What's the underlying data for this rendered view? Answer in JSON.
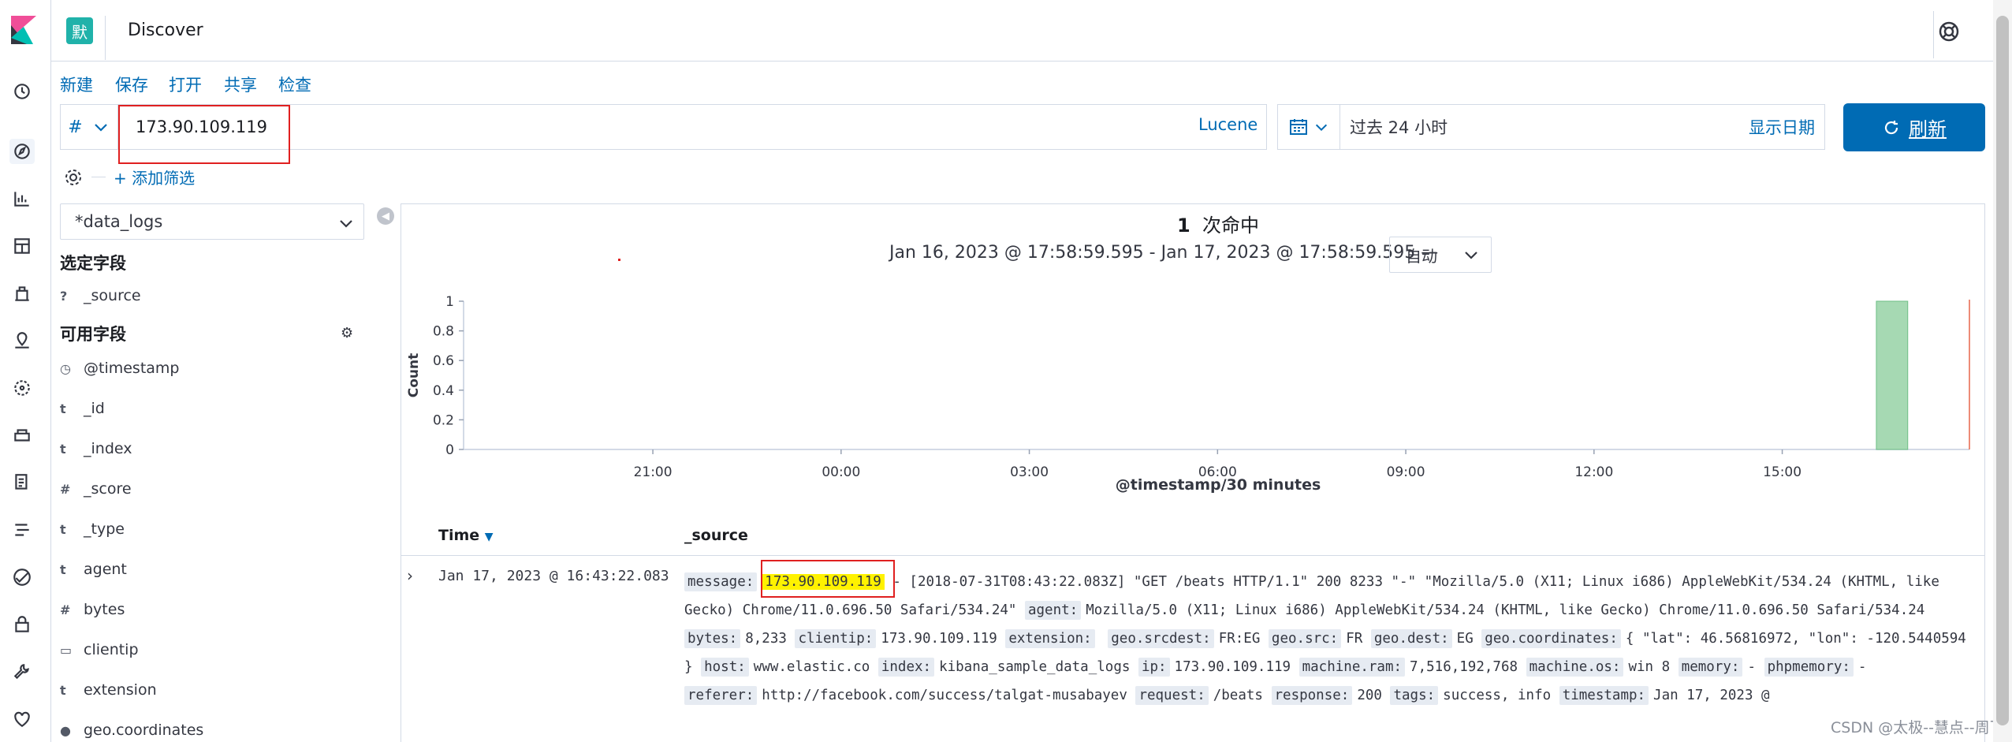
{
  "header": {
    "space_badge": "默",
    "app_title": "Discover"
  },
  "top_menu": [
    "新建",
    "保存",
    "打开",
    "共享",
    "检查"
  ],
  "query": {
    "type_symbol": "#",
    "value": "173.90.109.119",
    "language": "Lucene"
  },
  "date": {
    "range_text": "过去 24 小时",
    "show_dates": "显示日期",
    "refresh_label": "刷新"
  },
  "filters": {
    "add_filter": "+ 添加筛选"
  },
  "sidebar": {
    "index_pattern": "*data_logs",
    "selected_header": "选定字段",
    "selected_fields": [
      {
        "type": "?",
        "name": "_source"
      }
    ],
    "available_header": "可用字段",
    "available_fields": [
      {
        "type": "clock",
        "name": "@timestamp"
      },
      {
        "type": "t",
        "name": "_id"
      },
      {
        "type": "t",
        "name": "_index"
      },
      {
        "type": "#",
        "name": "_score"
      },
      {
        "type": "t",
        "name": "_type"
      },
      {
        "type": "t",
        "name": "agent"
      },
      {
        "type": "#",
        "name": "bytes"
      },
      {
        "type": "ip",
        "name": "clientip"
      },
      {
        "type": "t",
        "name": "extension"
      },
      {
        "type": "geo",
        "name": "geo.coordinates"
      }
    ]
  },
  "results": {
    "hit_count": "1",
    "hit_label": "次命中",
    "range_label": "Jan 16, 2023 @ 17:58:59.595 - Jan 17, 2023 @ 17:58:59.595 —",
    "interval": "自动"
  },
  "chart_data": {
    "type": "bar",
    "xlabel": "@timestamp/30 minutes",
    "ylabel": "Count",
    "ylim": [
      0,
      1
    ],
    "yticks": [
      "0",
      "0.2",
      "0.4",
      "0.6",
      "0.8",
      "1"
    ],
    "xticks": [
      "21:00",
      "00:00",
      "03:00",
      "06:00",
      "09:00",
      "12:00",
      "15:00"
    ],
    "bars": [
      {
        "x": "16:30",
        "value": 1
      }
    ],
    "bar_color": "#a6d9b3"
  },
  "table": {
    "col_time": "Time",
    "col_source": "_source",
    "row": {
      "time": "Jan 17, 2023 @ 16:43:22.083",
      "message_key": "message:",
      "message_hl": "173.90.109.119",
      "line1_rest": "- [2018-07-31T08:43:22.083Z] \"GET /beats HTTP/1.1\" 200 8233 \"-\" \"Mozilla/5.0 (X11; Linux i686) AppleWebKit/534.24 (KHTML, like",
      "line2": "Gecko) Chrome/11.0.696.50 Safari/534.24\"",
      "fields": [
        {
          "k": "agent:",
          "v": "Mozilla/5.0 (X11; Linux i686) AppleWebKit/534.24 (KHTML, like Gecko) Chrome/11.0.696.50 Safari/534.24"
        },
        {
          "k": "bytes:",
          "v": "8,233"
        },
        {
          "k": "clientip:",
          "v": "173.90.109.119"
        },
        {
          "k": "extension:",
          "v": ""
        },
        {
          "k": "geo.srcdest:",
          "v": "FR:EG"
        },
        {
          "k": "geo.src:",
          "v": "FR"
        },
        {
          "k": "geo.dest:",
          "v": "EG"
        },
        {
          "k": "geo.coordinates:",
          "v": "{ \"lat\": 46.56816972, \"lon\": -120.5440594 }"
        },
        {
          "k": "host:",
          "v": "www.elastic.co"
        },
        {
          "k": "index:",
          "v": "kibana_sample_data_logs"
        },
        {
          "k": "ip:",
          "v": "173.90.109.119"
        },
        {
          "k": "machine.ram:",
          "v": "7,516,192,768"
        },
        {
          "k": "machine.os:",
          "v": "win 8"
        },
        {
          "k": "memory:",
          "v": "-"
        },
        {
          "k": "phpmemory:",
          "v": "-"
        },
        {
          "k": "referer:",
          "v": "http://facebook.com/success/talgat-musabayev"
        },
        {
          "k": "request:",
          "v": "/beats"
        },
        {
          "k": "response:",
          "v": "200"
        },
        {
          "k": "tags:",
          "v": "success, info"
        },
        {
          "k": "timestamp:",
          "v": "Jan 17, 2023 @"
        }
      ]
    }
  },
  "watermark": "CSDN @太极--慧点--周飞",
  "colors": {
    "link": "#006bb4",
    "teal": "#20b2aa",
    "highlight": "#fff200",
    "annotation": "#e02020"
  }
}
